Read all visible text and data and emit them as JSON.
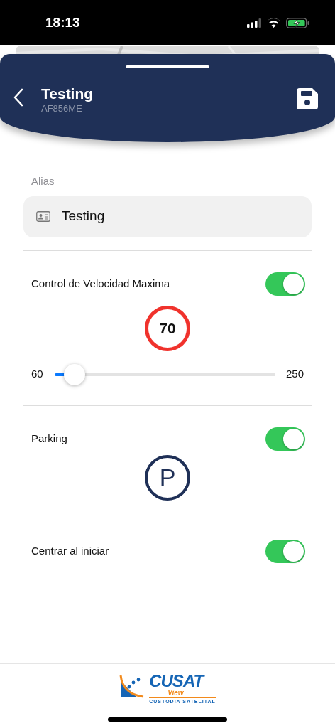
{
  "status_bar": {
    "time": "18:13"
  },
  "header": {
    "title": "Testing",
    "subtitle": "AF856ME"
  },
  "alias": {
    "label": "Alias",
    "value": "Testing"
  },
  "settings": [
    {
      "kind": "speed",
      "label": "Control de Velocidad Maxima",
      "on": true,
      "sign": "70",
      "min": "60",
      "max": "250",
      "level": 0.09
    },
    {
      "kind": "parking",
      "label": "Parking",
      "on": true,
      "sign": "P"
    },
    {
      "kind": "plain",
      "label": "Centrar al iniciar",
      "on": true
    }
  ],
  "footer": {
    "logo": {
      "name": "CUSAT",
      "sub": "View",
      "tagline": "CUSTODIA SATELITAL"
    }
  }
}
